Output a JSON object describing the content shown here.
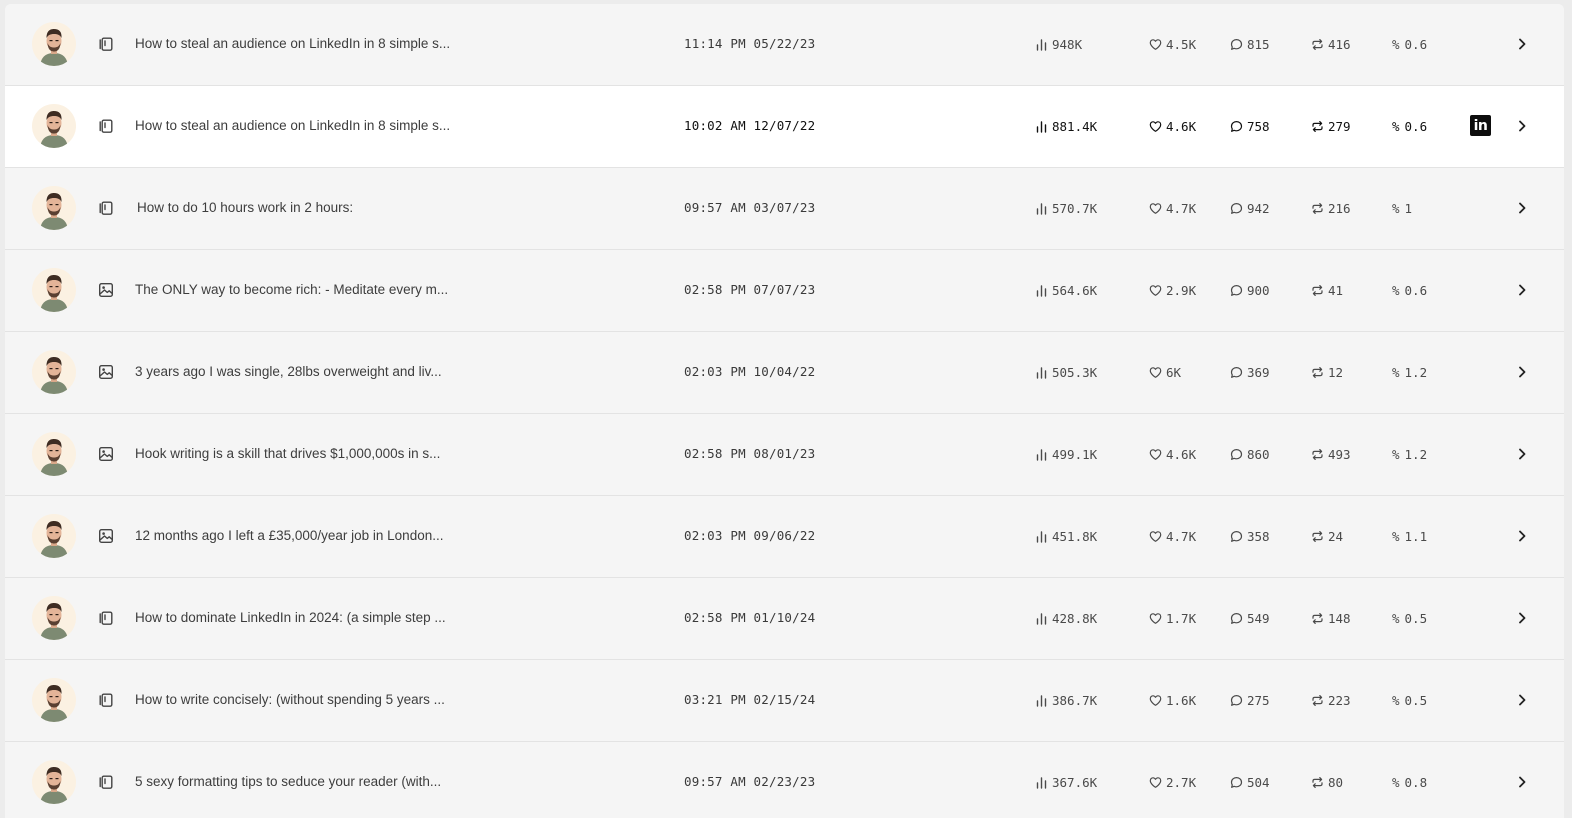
{
  "posts": [
    {
      "title": "How to steal an audience on LinkedIn in 8 simple s...",
      "date": "11:14 PM 05/22/23",
      "views": "948K",
      "likes": "4.5K",
      "comments": "815",
      "reposts": "416",
      "rate": "0.6",
      "type_icon": "carousel-icon"
    },
    {
      "title": "How to steal an audience on LinkedIn in 8 simple s...",
      "date": "10:02 AM 12/07/22",
      "views": "881.4K",
      "likes": "4.6K",
      "comments": "758",
      "reposts": "279",
      "rate": "0.6",
      "type_icon": "carousel-icon"
    },
    {
      "title": "How to do 10 hours work in 2 hours:",
      "date": "09:57 AM 03/07/23",
      "views": "570.7K",
      "likes": "4.7K",
      "comments": "942",
      "reposts": "216",
      "rate": "1",
      "type_icon": "carousel-icon"
    },
    {
      "title": "The ONLY way to become rich: - Meditate every m...",
      "date": "02:58 PM 07/07/23",
      "views": "564.6K",
      "likes": "2.9K",
      "comments": "900",
      "reposts": "41",
      "rate": "0.6",
      "type_icon": "image-icon"
    },
    {
      "title": "3 years ago I was single, 28lbs overweight and liv...",
      "date": "02:03 PM 10/04/22",
      "views": "505.3K",
      "likes": "6K",
      "comments": "369",
      "reposts": "12",
      "rate": "1.2",
      "type_icon": "image-icon"
    },
    {
      "title": "Hook writing is a skill that drives $1,000,000s in s...",
      "date": "02:58 PM 08/01/23",
      "views": "499.1K",
      "likes": "4.6K",
      "comments": "860",
      "reposts": "493",
      "rate": "1.2",
      "type_icon": "image-icon"
    },
    {
      "title": "12 months ago I left a £35,000/year job in London...",
      "date": "02:03 PM 09/06/22",
      "views": "451.8K",
      "likes": "4.7K",
      "comments": "358",
      "reposts": "24",
      "rate": "1.1",
      "type_icon": "image-icon"
    },
    {
      "title": "How to dominate LinkedIn in 2024: (a simple step ...",
      "date": "02:58 PM 01/10/24",
      "views": "428.8K",
      "likes": "1.7K",
      "comments": "549",
      "reposts": "148",
      "rate": "0.5",
      "type_icon": "carousel-icon"
    },
    {
      "title": "How to write concisely: (without spending 5 years ...",
      "date": "03:21 PM 02/15/24",
      "views": "386.7K",
      "likes": "1.6K",
      "comments": "275",
      "reposts": "223",
      "rate": "0.5",
      "type_icon": "carousel-icon"
    },
    {
      "title": "5 sexy formatting tips to seduce your reader (with...",
      "date": "09:57 AM 02/23/23",
      "views": "367.6K",
      "likes": "2.7K",
      "comments": "504",
      "reposts": "80",
      "rate": "0.8",
      "type_icon": "carousel-icon"
    }
  ],
  "active_row": 1,
  "rate_symbol": "%",
  "linkedin_label": "in",
  "colors": {
    "row_bg": "#f5f5f5",
    "active_row_bg": "#ffffff",
    "text": "#3d3d3d",
    "linkedin_badge": "#0d0d0d"
  }
}
